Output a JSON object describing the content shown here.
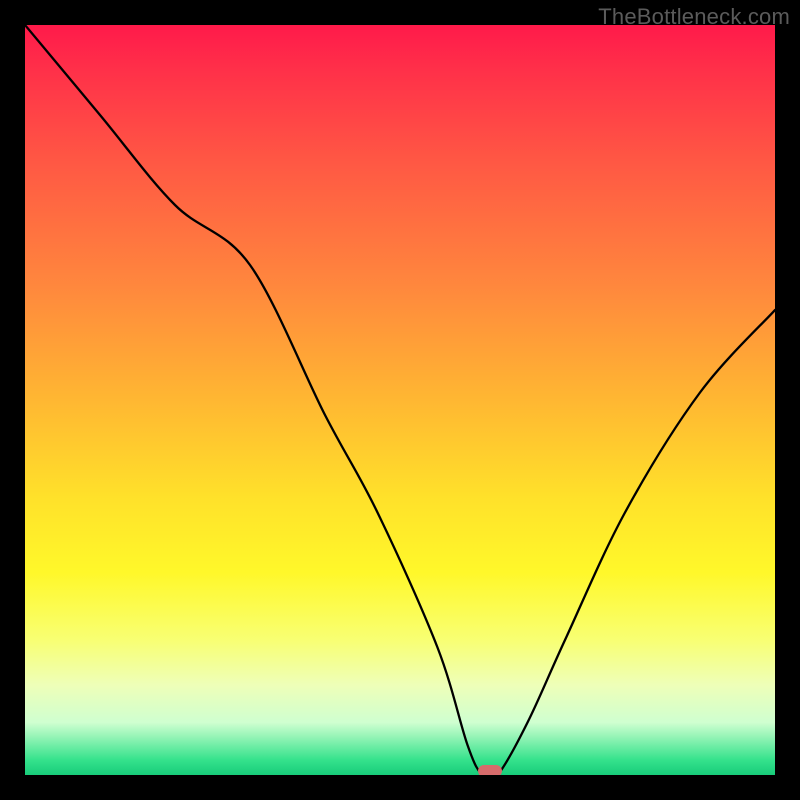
{
  "watermark": "TheBottleneck.com",
  "chart_data": {
    "type": "line",
    "title": "",
    "xlabel": "",
    "ylabel": "",
    "xlim": [
      0,
      100
    ],
    "ylim": [
      0,
      100
    ],
    "grid": false,
    "series": [
      {
        "name": "bottleneck-curve",
        "x": [
          0,
          10,
          20,
          30,
          40,
          47,
          55,
          59,
          61,
          63,
          67,
          72,
          80,
          90,
          100
        ],
        "values": [
          100,
          88,
          76,
          68,
          48,
          35,
          17,
          4,
          0,
          0,
          7,
          18,
          35,
          51,
          62
        ]
      }
    ],
    "marker": {
      "x": 62,
      "y": 0.5,
      "width_pct": 3.2,
      "height_pct": 1.6
    },
    "background_gradient": {
      "top": "#ff1a4a",
      "middle": "#ffe12a",
      "bottom": "#18cc7a"
    }
  }
}
